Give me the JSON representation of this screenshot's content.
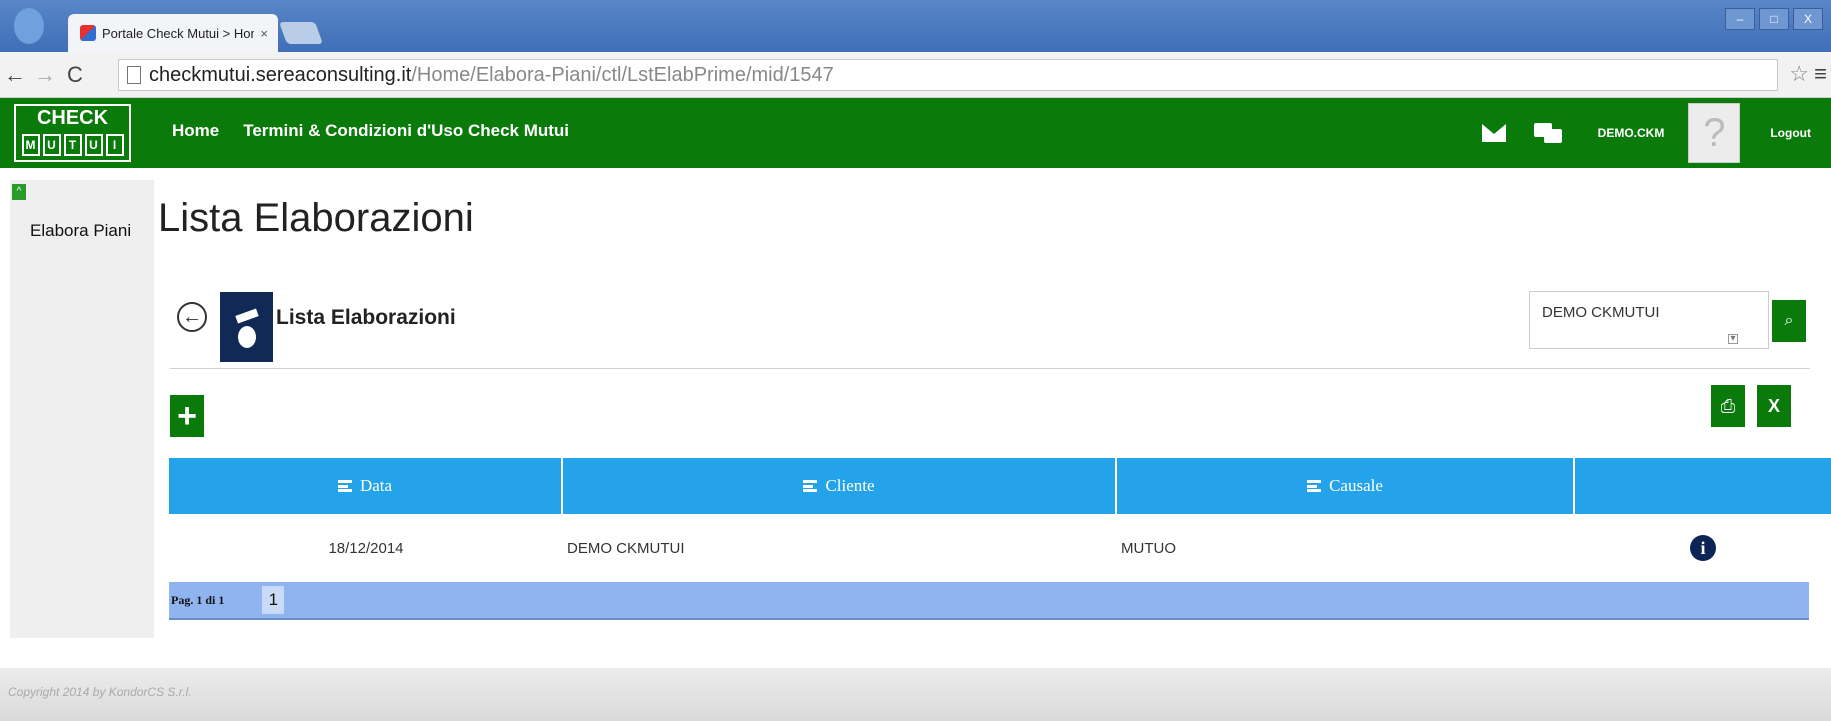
{
  "browser": {
    "tab_title": "Portale Check Mutui > Home",
    "tab_close": "×",
    "url_host": "checkmutui.sereaconsulting.it",
    "url_path": "/Home/Elabora-Piani/ctl/LstElabPrime/mid/1547",
    "window_buttons": [
      "–",
      "□",
      "X"
    ]
  },
  "app": {
    "logo_top": "CHECK",
    "logo_letters": [
      "M",
      "U",
      "T",
      "U",
      "I"
    ],
    "nav": [
      "Home",
      "Termini & Condizioni d'Uso Check Mutui"
    ],
    "user_name": "DEMO.CKM",
    "logout": "Logout",
    "brand_color": "#0a7a0a"
  },
  "sidebar": {
    "collapse": "^",
    "items": [
      {
        "label": "Elabora Piani"
      }
    ]
  },
  "main": {
    "page_title": "Lista Elaborazioni",
    "section_title": "Lista Elaborazioni",
    "client_filter": "DEMO CKMUTUI",
    "grid": {
      "columns": [
        "Data",
        "Cliente",
        "Causale",
        ""
      ],
      "rows": [
        {
          "data": "18/12/2014",
          "cliente": "DEMO CKMUTUI",
          "causale": "MUTUO"
        }
      ],
      "pager_label": "Pag. 1 di 1",
      "current_page": "1",
      "header_color": "#25a3ea"
    }
  },
  "footer": {
    "copyright": "Copyright 2014 by KondorCS S.r.l."
  },
  "icons": [
    "back-icon",
    "mail-icon",
    "chat-icon",
    "search-icon",
    "add-icon",
    "print-icon",
    "excel-export-icon",
    "info-icon",
    "sort-icon"
  ]
}
